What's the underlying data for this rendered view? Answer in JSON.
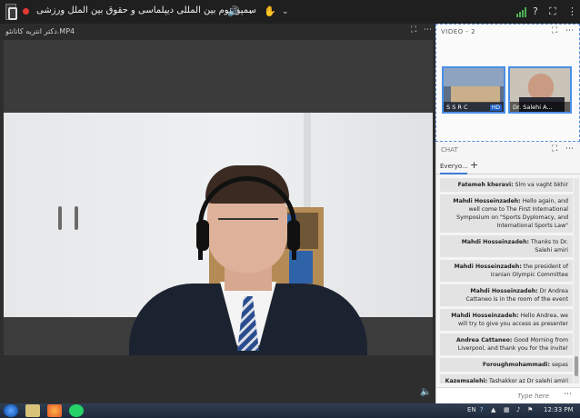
{
  "topbar": {
    "title": "سمپوزیوم بین المللی دیپلماسی و حقوق بین الملل ورزشی",
    "icons": {
      "speaker": "speaker-icon",
      "hand": "raise-hand-icon",
      "signal": "signal-icon",
      "help": "help-icon",
      "fullscreen": "fullscreen-icon",
      "more": "more-icon"
    }
  },
  "main_pod": {
    "title": "دکتر انتریه کاتانئو.MP4"
  },
  "video_pod": {
    "title": "VIDEO - 2",
    "thumbs": [
      {
        "label": "S S R C",
        "hd": "HD"
      },
      {
        "label": "Dr. Salehi A..."
      }
    ]
  },
  "chat_pod": {
    "title": "CHAT",
    "tab": "Everyo...",
    "add": "+",
    "input_placeholder": "Type here",
    "messages": [
      {
        "sender": "Fatemeh kheravi:",
        "text": " Slm va vaght bkhir"
      },
      {
        "sender": "Mahdi Hosseinzadeh:",
        "text": " Hello again, and well come to The First International Symposium on \"Sports Dyplomacy, and International Sports Law\""
      },
      {
        "sender": "Mahdi Hosseinzadeh:",
        "text": " Thanks to Dr. Salehi amiri"
      },
      {
        "sender": "Mahdi Hosseinzadeh:",
        "text": " the president of Iranian Olympic Committee"
      },
      {
        "sender": "Mahdi Hosseinzadeh:",
        "text": " Dr Andrea Cattaneo is in the room of the event"
      },
      {
        "sender": "Mahdi Hosseinzadeh:",
        "text": " Hello Andrea, we will try to give you access as presenter"
      },
      {
        "sender": "Andrea Cattaneo:",
        "text": " Good Morning from Liverpool, and thank you for the invite!"
      },
      {
        "sender": "Foroughmohammadi:",
        "text": " sepas"
      },
      {
        "sender": "Kazemsalehi:",
        "text": " Tashakkor az Dr salehi amiri"
      }
    ]
  },
  "taskbar": {
    "lang": "EN",
    "time": "12:33 PM"
  },
  "colors": {
    "accent": "#3a7bd5",
    "record": "#e53935",
    "speaker": "#4caf50"
  }
}
